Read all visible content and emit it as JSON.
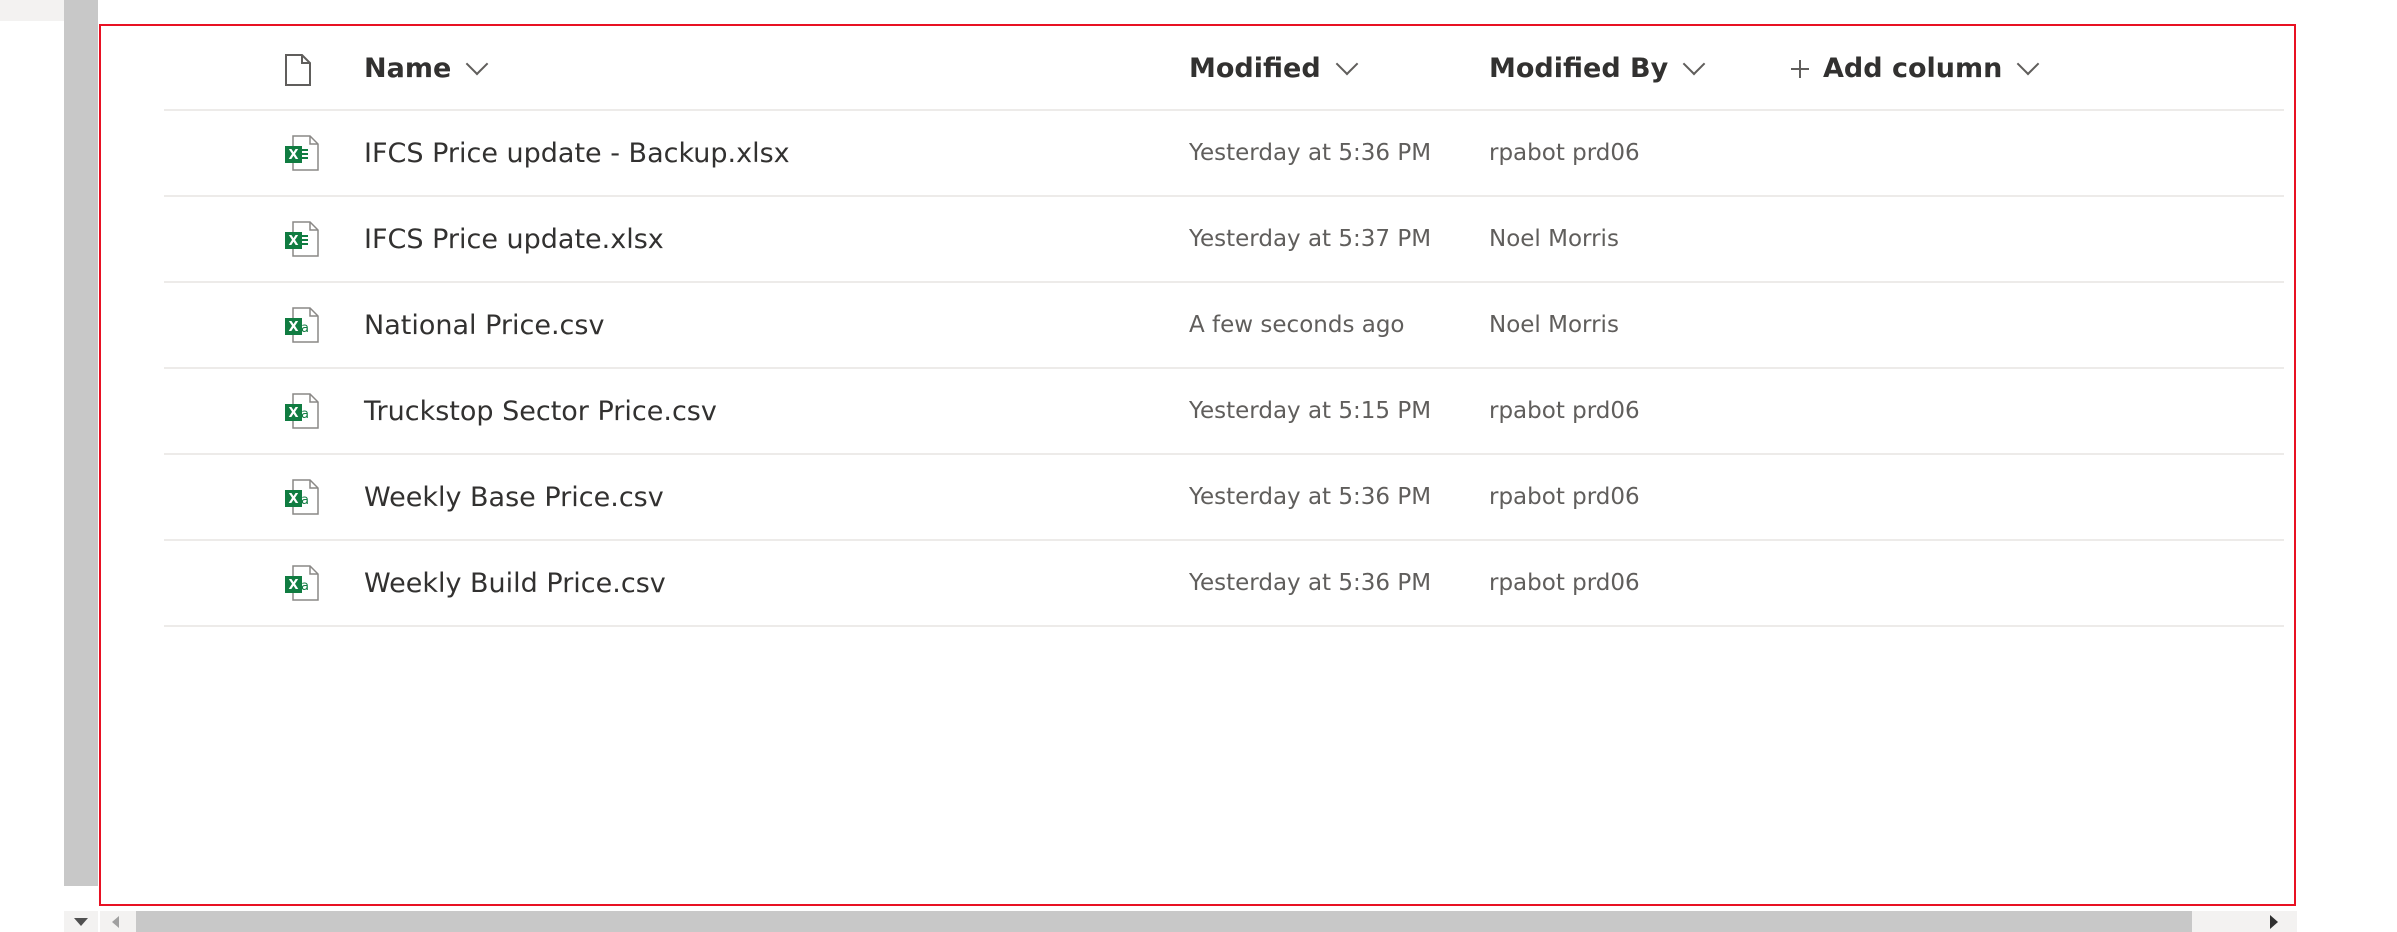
{
  "columns": {
    "name": "Name",
    "modified": "Modified",
    "modified_by": "Modified By",
    "add_column": "Add column"
  },
  "files": [
    {
      "name": "IFCS Price update - Backup.xlsx",
      "modified": "Yesterday at 5:36 PM",
      "modified_by": "rpabot prd06",
      "icon": "excel-xlsx-icon"
    },
    {
      "name": "IFCS Price update.xlsx",
      "modified": "Yesterday at 5:37 PM",
      "modified_by": "Noel Morris",
      "icon": "excel-xlsx-icon"
    },
    {
      "name": "National Price.csv",
      "modified": "A few seconds ago",
      "modified_by": "Noel Morris",
      "icon": "excel-csv-icon"
    },
    {
      "name": "Truckstop Sector Price.csv",
      "modified": "Yesterday at 5:15 PM",
      "modified_by": "rpabot prd06",
      "icon": "excel-csv-icon"
    },
    {
      "name": "Weekly Base Price.csv",
      "modified": "Yesterday at 5:36 PM",
      "modified_by": "rpabot prd06",
      "icon": "excel-csv-icon"
    },
    {
      "name": "Weekly Build Price.csv",
      "modified": "Yesterday at 5:36 PM",
      "modified_by": "rpabot prd06",
      "icon": "excel-csv-icon"
    }
  ],
  "colors": {
    "excel_green": "#107c41",
    "highlight_border": "#e81123",
    "row_divider": "#edebe9"
  }
}
